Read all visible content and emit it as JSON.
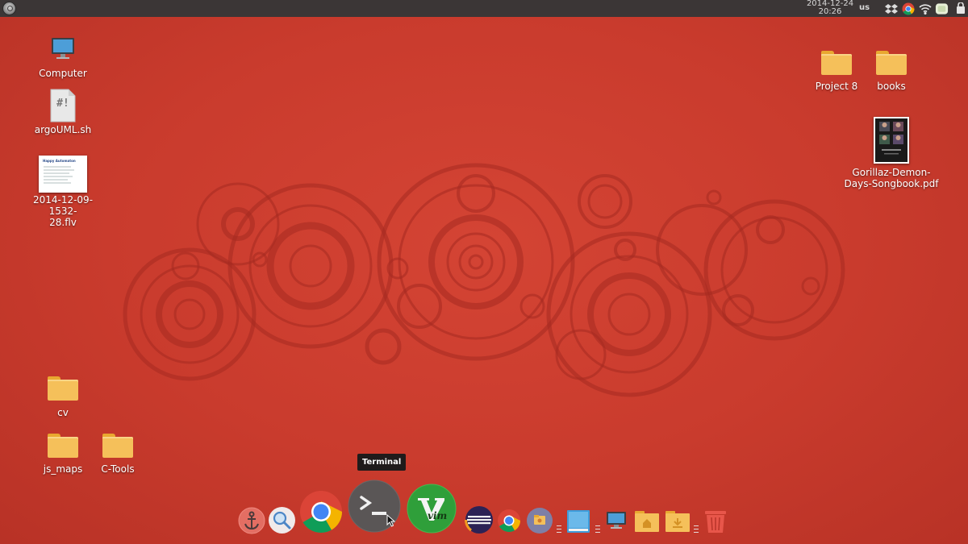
{
  "top_panel": {
    "menu_icon": "ubuntu-menu-icon",
    "date": "2014-12-24",
    "time": "20:26",
    "keyboard_layout": "us",
    "tray_icons": [
      "dropbox-icon",
      "chrome-icon",
      "wifi-icon",
      "battery-icon",
      "power-icon"
    ]
  },
  "desktop": {
    "icons": {
      "computer": "Computer",
      "argouml": "argoUML.sh",
      "argouml_glyph": "#!",
      "video_line1": "2014-12-09-1532-",
      "video_line2": "28.flv",
      "project8": "Project 8",
      "books": "books",
      "pdf_line1": "Gorillaz-Demon-",
      "pdf_line2": "Days-Songbook.pdf",
      "cv": "cv",
      "js_maps": "js_maps",
      "ctools": "C-Tools"
    },
    "video_thumb_title": "Happy Automaton"
  },
  "dock": {
    "tooltip": "Terminal",
    "items": [
      "anchor-icon",
      "search-icon",
      "chrome-icon",
      "terminal-icon",
      "vim-icon",
      "eclipse-icon",
      "chrome-icon",
      "file-manager-icon",
      "text-editor-icon",
      "monitor-icon",
      "home-folder-icon",
      "downloads-folder-icon",
      "trash-icon"
    ],
    "vim_label": "vim"
  },
  "colors": {
    "wallpaper": "#c93b2d",
    "panel": "#3b3636",
    "folder": "#f5c05a",
    "vim_green": "#2f9f3a"
  }
}
